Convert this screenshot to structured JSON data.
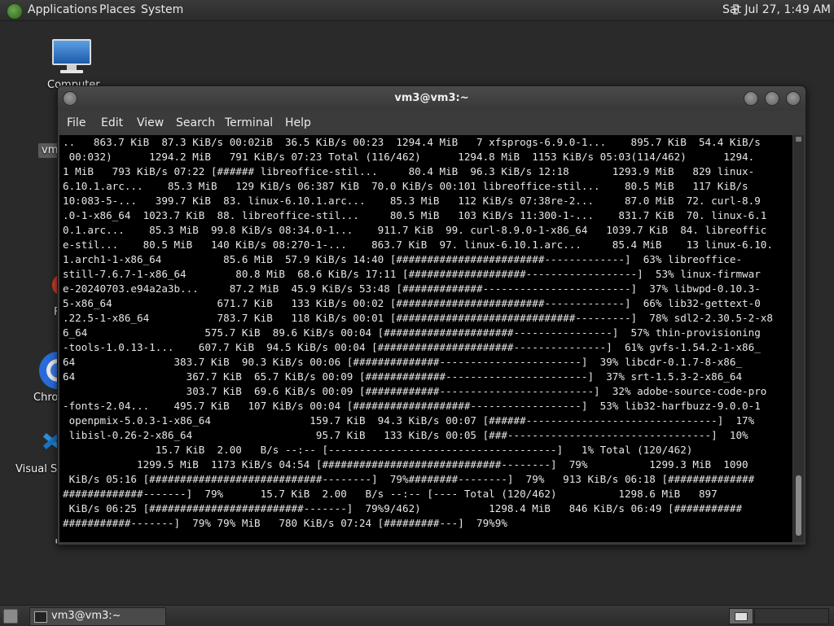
{
  "top_panel": {
    "menu": [
      "Applications",
      "Places",
      "System"
    ],
    "clock": "Sat Jul 27,  1:49 AM"
  },
  "desktop": {
    "icons": [
      {
        "label": "Computer",
        "icon": "computer-icon"
      },
      {
        "label": "vm",
        "icon": "home-folder-icon"
      },
      {
        "label": "F",
        "icon": "app-icon"
      },
      {
        "label": "Chro",
        "icon": "chrome-icon"
      },
      {
        "label": "Visual St",
        "icon": "vscode-icon"
      }
    ]
  },
  "window": {
    "title": "vm3@vm3:~",
    "menu": [
      "File",
      "Edit",
      "View",
      "Search",
      "Terminal",
      "Help"
    ],
    "terminal_lines": [
      "..   863.7 KiB  87.3 KiB/s 00:02iB  36.5 KiB/s 00:23  1294.4 MiB   7 xfsprogs-6.9.0-1...    895.7 KiB  54.4 KiB/s",
      " 00:032)      1294.2 MiB   791 KiB/s 07:23 Total (116/462)      1294.8 MiB  1153 KiB/s 05:03(114/462)      1294.",
      "1 MiB   793 KiB/s 07:22 [###### libreoffice-stil...     80.4 MiB  96.3 KiB/s 12:18       1293.9 MiB   829 linux-",
      "6.10.1.arc...    85.3 MiB   129 KiB/s 06:387 KiB  70.0 KiB/s 00:101 libreoffice-stil...    80.5 MiB   117 KiB/s",
      "10:083-5-...   399.7 KiB  83. linux-6.10.1.arc...    85.3 MiB   112 KiB/s 07:38re-2...     87.0 MiB  72. curl-8.9",
      ".0-1-x86_64  1023.7 KiB  88. libreoffice-stil...     80.5 MiB   103 KiB/s 11:300-1-...    831.7 KiB  70. linux-6.1",
      "0.1.arc...    85.3 MiB  99.8 KiB/s 08:34.0-1...    911.7 KiB  99. curl-8.9.0-1-x86_64   1039.7 KiB  84. libreoffic",
      "e-stil...    80.5 MiB   140 KiB/s 08:270-1-...    863.7 KiB  97. linux-6.10.1.arc...     85.4 MiB    13 linux-6.10.",
      "1.arch1-1-x86_64          85.6 MiB  57.9 KiB/s 14:40 [########################-------------]  63% libreoffice-",
      "still-7.6.7-1-x86_64        80.8 MiB  68.6 KiB/s 17:11 [###################------------------]  53% linux-firmwar",
      "e-20240703.e94a2a3b...     87.2 MiB  45.9 KiB/s 53:48 [#############------------------------]  37% libwpd-0.10.3-",
      "5-x86_64                 671.7 KiB   133 KiB/s 00:02 [########################-------------]  66% lib32-gettext-0",
      ".22.5-1-x86_64           783.7 KiB   118 KiB/s 00:01 [#############################---------]  78% sdl2-2.30.5-2-x8",
      "6_64                   575.7 KiB  89.6 KiB/s 00:04 [#####################----------------]  57% thin-provisioning",
      "-tools-1.0.13-1...    607.7 KiB  94.5 KiB/s 00:04 [######################---------------]  61% gvfs-1.54.2-1-x86_",
      "64                383.7 KiB  90.3 KiB/s 00:06 [##############-----------------------]  39% libcdr-0.1.7-8-x86_",
      "64                  367.7 KiB  65.7 KiB/s 00:09 [#############-----------------------]  37% srt-1.5.3-2-x86_64",
      "                    303.7 KiB  69.6 KiB/s 00:09 [############-------------------------]  32% adobe-source-code-pro",
      "-fonts-2.04...    495.7 KiB   107 KiB/s 00:04 [###################------------------]  53% lib32-harfbuzz-9.0.0-1",
      " openpmix-5.0.3-1-x86_64                159.7 KiB  94.3 KiB/s 00:07 [######-------------------------------]  17%",
      " libisl-0.26-2-x86_64                    95.7 KiB   133 KiB/s 00:05 [###---------------------------------]  10%",
      "               15.7 KiB  2.00   B/s --:-- [-------------------------------------]   1% Total (120/462)",
      "            1299.5 MiB  1173 KiB/s 04:54 [#############################--------]  79%          1299.3 MiB  1090",
      " KiB/s 05:16 [############################--------]  79%########--------]  79%   913 KiB/s 06:18 [##############",
      "#############-------]  79%      15.7 KiB  2.00   B/s --:-- [---- Total (120/462)          1298.6 MiB   897",
      " KiB/s 06:25 [#########################-------]  79%9/462)           1298.4 MiB   846 KiB/s 06:49 [###########",
      "###########-------]  79% 79% MiB   780 KiB/s 07:24 [#########---]  79%9%"
    ]
  },
  "bottom_panel": {
    "task_label": "vm3@vm3:~"
  }
}
